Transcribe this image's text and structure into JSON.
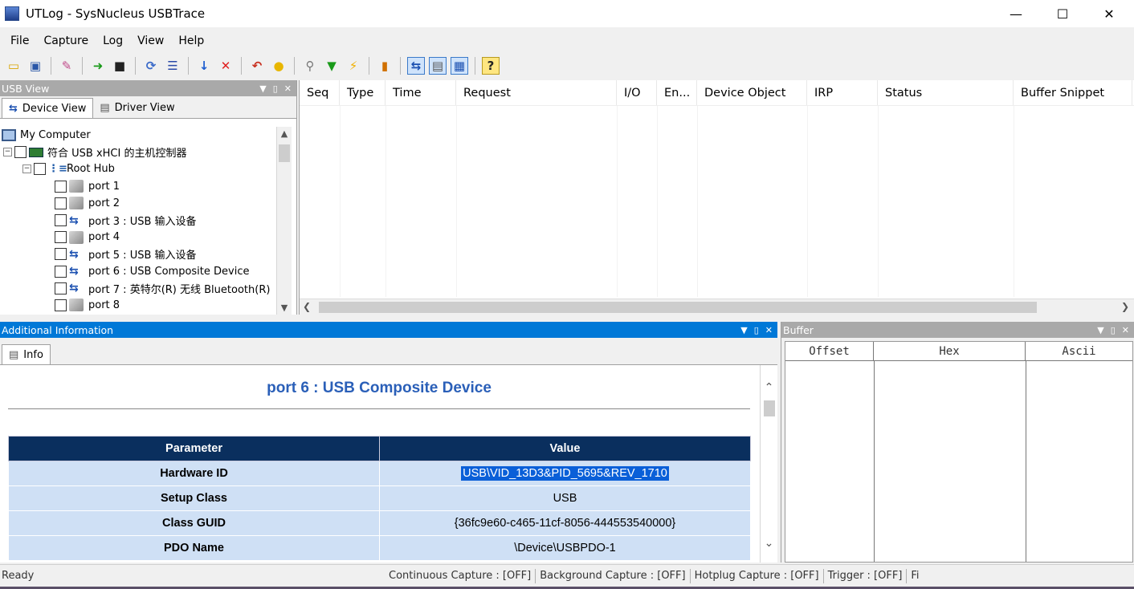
{
  "window": {
    "title": "UTLog - SysNucleus USBTrace",
    "controls": [
      "—",
      "☐",
      "✕"
    ]
  },
  "menu": [
    "File",
    "Capture",
    "Log",
    "View",
    "Help"
  ],
  "usb_view": {
    "title": "USB View",
    "tabs": [
      "Device View",
      "Driver View"
    ],
    "tree": [
      {
        "label": "My Computer",
        "icon": "computer-icon",
        "level": 0
      },
      {
        "label": "符合 USB xHCI 的主机控制器",
        "icon": "controller-icon",
        "level": 1
      },
      {
        "label": "Root Hub",
        "icon": "hub-icon",
        "level": 2
      },
      {
        "label": "port 1",
        "icon": "empty-port-icon",
        "level": 3
      },
      {
        "label": "port 2",
        "icon": "empty-port-icon",
        "level": 3
      },
      {
        "label": "port 3 : USB 输入设备",
        "icon": "usb-icon",
        "level": 3
      },
      {
        "label": "port 4",
        "icon": "empty-port-icon",
        "level": 3
      },
      {
        "label": "port 5 : USB 输入设备",
        "icon": "usb-icon",
        "level": 3
      },
      {
        "label": "port 6 : USB Composite Device",
        "icon": "usb-icon",
        "level": 3
      },
      {
        "label": "port 7 : 英特尔(R) 无线 Bluetooth(R)",
        "icon": "usb-icon",
        "level": 3
      },
      {
        "label": "port 8",
        "icon": "empty-port-icon",
        "level": 3
      }
    ]
  },
  "log": {
    "columns": [
      "Seq",
      "Type",
      "Time",
      "Request",
      "I/O",
      "En...",
      "Device Object",
      "IRP",
      "Status",
      "Buffer Snippet"
    ]
  },
  "additional_info": {
    "title": "Additional Information",
    "tab": "Info",
    "heading": "port 6 : USB Composite Device",
    "table_headers": [
      "Parameter",
      "Value"
    ],
    "rows": [
      {
        "param": "Hardware ID",
        "value": "USB\\VID_13D3&PID_5695&REV_1710"
      },
      {
        "param": "Setup Class",
        "value": "USB"
      },
      {
        "param": "Class GUID",
        "value": "{36fc9e60-c465-11cf-8056-444553540000}"
      },
      {
        "param": "PDO Name",
        "value": "\\Device\\USBPDO-1"
      }
    ]
  },
  "buffer": {
    "title": "Buffer",
    "columns": [
      "Offset",
      "Hex",
      "Ascii"
    ]
  },
  "status": {
    "ready": "Ready",
    "items": [
      "Continuous Capture : [OFF]",
      "Background Capture : [OFF]",
      "Hotplug Capture : [OFF]",
      "Trigger : [OFF]",
      "Fi"
    ]
  }
}
